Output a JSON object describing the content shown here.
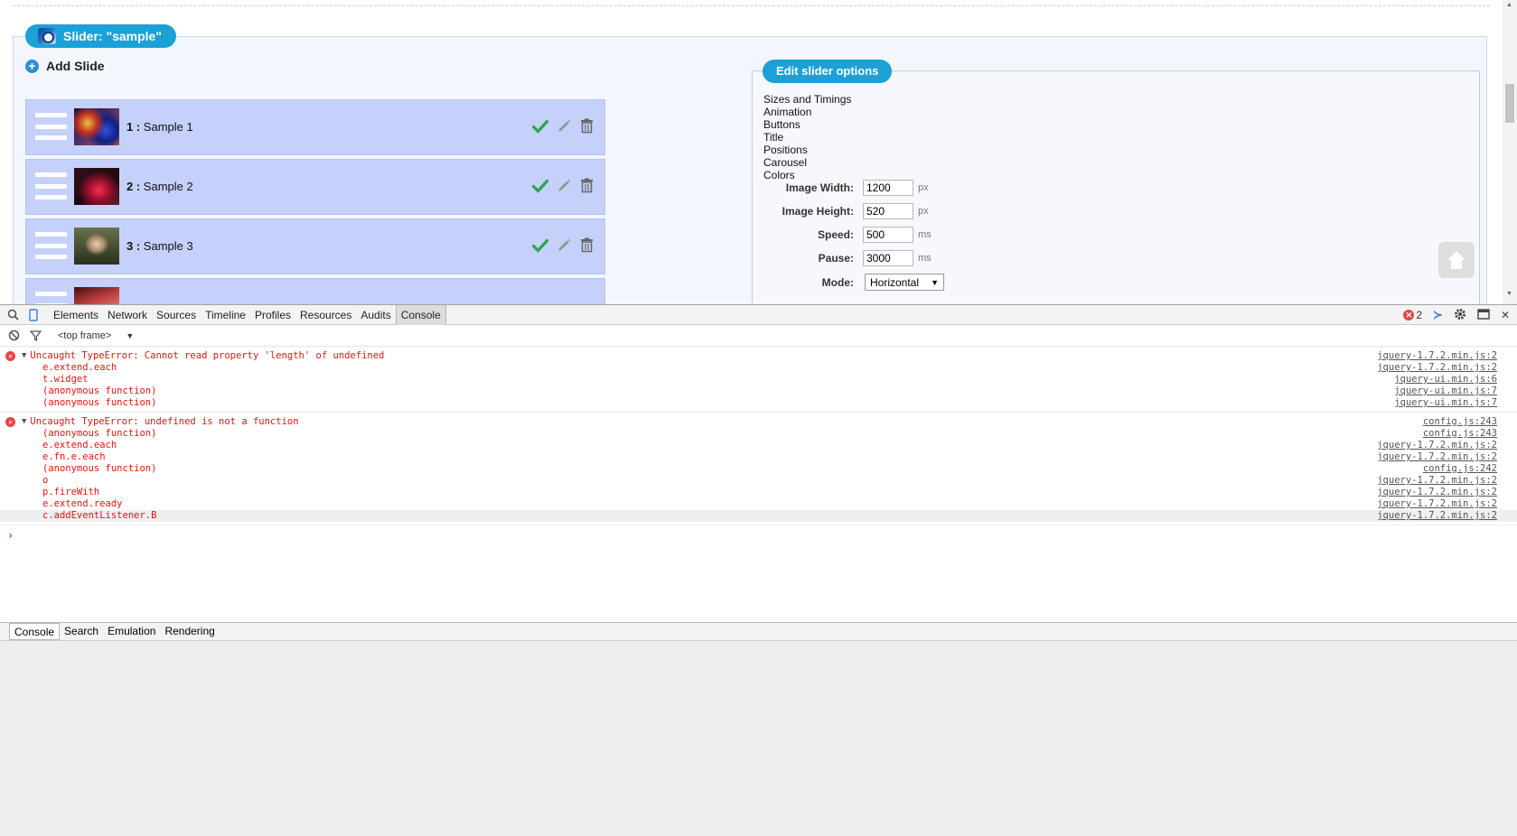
{
  "page": {
    "slider_header": "Slider: \"sample\"",
    "add_slide": "Add Slide",
    "slides": [
      {
        "number": "1",
        "name": " Sample 1"
      },
      {
        "number": "2",
        "name": " Sample 2"
      },
      {
        "number": "3",
        "name": " Sample 3"
      }
    ],
    "edit_options_title": "Edit slider options",
    "option_links": [
      "Sizes and Timings",
      "Animation",
      "Buttons",
      "Title",
      "Positions",
      "Carousel",
      "Colors"
    ],
    "fields": {
      "image_width": {
        "label": "Image Width:",
        "value": "1200",
        "unit": "px"
      },
      "image_height": {
        "label": "Image Height:",
        "value": "520",
        "unit": "px"
      },
      "speed": {
        "label": "Speed:",
        "value": "500",
        "unit": "ms"
      },
      "pause": {
        "label": "Pause:",
        "value": "3000",
        "unit": "ms"
      },
      "mode": {
        "label": "Mode:",
        "value": "Horizontal"
      }
    }
  },
  "devtools": {
    "tabs": [
      "Elements",
      "Network",
      "Sources",
      "Timeline",
      "Profiles",
      "Resources",
      "Audits",
      "Console"
    ],
    "active_tab": "Console",
    "error_count": "2",
    "frame": "<top frame>",
    "messages": [
      {
        "text": "Uncaught TypeError: Cannot read property 'length' of undefined",
        "source": "jquery-1.7.2.min.js:2",
        "stack": [
          {
            "fn": "e.extend.each",
            "src": "jquery-1.7.2.min.js:2"
          },
          {
            "fn": "t.widget",
            "src": "jquery-ui.min.js:6"
          },
          {
            "fn": "(anonymous function)",
            "src": "jquery-ui.min.js:7"
          },
          {
            "fn": "(anonymous function)",
            "src": "jquery-ui.min.js:7"
          }
        ]
      },
      {
        "text": "Uncaught TypeError: undefined is not a function",
        "source": "config.js:243",
        "stack": [
          {
            "fn": "(anonymous function)",
            "src": "config.js:243"
          },
          {
            "fn": "e.extend.each",
            "src": "jquery-1.7.2.min.js:2"
          },
          {
            "fn": "e.fn.e.each",
            "src": "jquery-1.7.2.min.js:2"
          },
          {
            "fn": "(anonymous function)",
            "src": "config.js:242"
          },
          {
            "fn": "o",
            "src": "jquery-1.7.2.min.js:2"
          },
          {
            "fn": "p.fireWith",
            "src": "jquery-1.7.2.min.js:2"
          },
          {
            "fn": "e.extend.ready",
            "src": "jquery-1.7.2.min.js:2"
          },
          {
            "fn": "c.addEventListener.B",
            "src": "jquery-1.7.2.min.js:2"
          }
        ]
      }
    ],
    "drawer_tabs": [
      "Console",
      "Search",
      "Emulation",
      "Rendering"
    ],
    "drawer_active": "Console"
  },
  "colors": {
    "accent": "#1ba1d6",
    "slide_row": "#c5d1fb",
    "error": "#e11111",
    "check": "#2da44e"
  }
}
